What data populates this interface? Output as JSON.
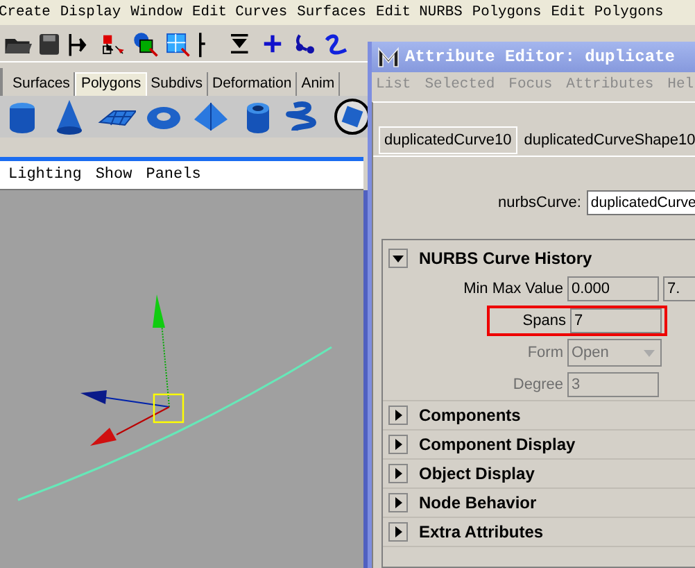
{
  "menu_bar": [
    "Create",
    "Display",
    "Window",
    "Edit Curves",
    "Surfaces",
    "Edit NURBS",
    "Polygons",
    "Edit Polygons"
  ],
  "shelf_tabs": [
    {
      "label": "Surfaces",
      "selected": false
    },
    {
      "label": "Polygons",
      "selected": true
    },
    {
      "label": "Subdivs",
      "selected": false
    },
    {
      "label": "Deformation",
      "selected": false
    },
    {
      "label": "Anim",
      "selected": false
    }
  ],
  "panel_menu": [
    "Lighting",
    "Show",
    "Panels"
  ],
  "attribute_editor": {
    "title": "Attribute Editor: duplicate",
    "menu": [
      "List",
      "Selected",
      "Focus",
      "Attributes",
      "Hel"
    ],
    "tabs": [
      {
        "label": "duplicatedCurve10",
        "selected": false
      },
      {
        "label": "duplicatedCurveShape10",
        "selected": true
      }
    ],
    "node_type_label": "nurbsCurve:",
    "node_name": "duplicatedCurve",
    "sections": [
      {
        "title": "NURBS Curve History",
        "expanded": true,
        "attributes": [
          {
            "kind": "fields",
            "label": "Min Max Value",
            "values": [
              "0.000",
              "7."
            ],
            "disabled": false,
            "highlighted": false
          },
          {
            "kind": "fields",
            "label": "Spans",
            "values": [
              "7"
            ],
            "disabled": false,
            "highlighted": true
          },
          {
            "kind": "dropdown",
            "label": "Form",
            "values": [
              "Open"
            ],
            "disabled": true,
            "highlighted": false
          },
          {
            "kind": "fields",
            "label": "Degree",
            "values": [
              "3"
            ],
            "disabled": true,
            "highlighted": false
          }
        ]
      },
      {
        "title": "Components",
        "expanded": false
      },
      {
        "title": "Component Display",
        "expanded": false
      },
      {
        "title": "Object Display",
        "expanded": false
      },
      {
        "title": "Node Behavior",
        "expanded": false
      },
      {
        "title": "Extra Attributes",
        "expanded": false
      }
    ]
  }
}
